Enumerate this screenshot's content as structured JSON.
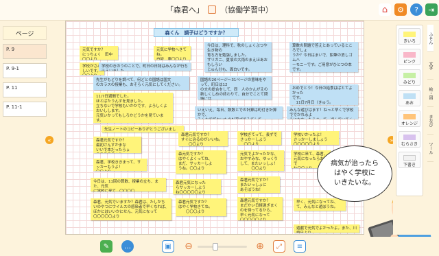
{
  "header": {
    "title": "「森君へ」",
    "mode": "（協働学習中）"
  },
  "left": {
    "label": "ページ",
    "pages": [
      "P. 9",
      "P. 9-1",
      "P. 11",
      "P. 11-1"
    ]
  },
  "board": {
    "heading": "森くん　調子はどうですか？",
    "notes": [
      {
        "t": "元気ですか？\nにっちょく　田中〇〇より",
        "c": "yellow"
      },
      {
        "t": "元気に学校へきてね。\n白坂　東〇〇より",
        "c": "yellow"
      },
      {
        "t": "学校がさみしいです。\n〇〇より",
        "c": "yellow"
      },
      {
        "t": "今日は、理科で、秋のしょくぶつや生き物の\n育ち方を勉強しました。\nザリガニ、夏頃の大雨のまえほあおもしろい\nじゅん分も、面白いです。\n　　　　　　　　　　日氏より",
        "c": "blue"
      },
      {
        "t": "算数の問題で答えとあっているところでしょ\nうか？今日はまいで、鉛筆の消しゴムハ\nーモニーです。ご用意がひとつの本です。\n　　　いそご案をかいてください。",
        "c": "blue"
      },
      {
        "t": "学校のきのうのことで、町日の日誌はみんなが行ち込えいました。",
        "c": "blue"
      },
      {
        "t": "先生がもどりを調べて、何どとの国語は国文\nのカラスの授業も、おそらく元気にしてください。",
        "c": "blue"
      },
      {
        "t": "国語の26ページ～31ページの意味をやって、町日は12\nの文の総合をして、同　人のかんがえの\n新しくしめの終わりて、自分でことて問題に共\n出ます。",
        "c": "blue"
      },
      {
        "t": "おめでとう！今日の給食はぱとてよかった\nです。\n　11日7月日（きゅう。",
        "c": "blue"
      },
      {
        "t": "11/7日週間でした。\nほとばたうんすを見ました。\n立ちないで学校もいかかです、よろしくよおいしします。\n元気いかってもしろかどうかを見ています。\n遊戯たいらいしいよんをまんなが\n　　　　　　　　　　〇〇より",
        "c": "yellow"
      },
      {
        "t": "いえいえ、毎日、数数とでの計算は町付き計算かで、\nみんなで紙ないもの計算ボでみてして。",
        "c": "blue"
      },
      {
        "t": "みんな遊びはます！ねっと早くで学校ででかれるよ\nうになかったらまって、遊んでいてください。",
        "c": "blue"
      },
      {
        "t": "先生ノートのコピーありがとうございました。",
        "c": "yellow"
      },
      {
        "t": "森君元気ですか？\nすぐに治るのがいいね。\n　　〇〇より",
        "c": "yellow"
      },
      {
        "t": "学校ぎてって、長ずで\nさっかーしよう\n　〇〇より",
        "c": "yellow"
      },
      {
        "t": "学校いかったよ！\nさっかーしましょう\n〇〇〇〇〇より",
        "c": "yellow"
      },
      {
        "t": "森君元気ですか？\n最初けんすかまな\nいいで本だったらょ\n〇〇〇〇〇より",
        "c": "yellow"
      },
      {
        "t": "森君、学校ききまって、サッカーもうよ！\n〇〇より",
        "c": "yellow"
      },
      {
        "t": "森元気ですか？\nはやくよくってね、\nまだ、サッカーしよ\nうね。〇〇より",
        "c": "yellow"
      },
      {
        "t": "元気でよかったかな、\nおやすみな、ゆっくり\nして、またいっしょ！\n　　　〇〇より",
        "c": "yellow"
      },
      {
        "t": "学校に来て、森君、\n元気になったらおいで\nね〇〇より",
        "c": "yellow"
      },
      {
        "t": "今日は、11回の算数、授業の立ち、また、元気\nに学校に来て、〇〇〇〇",
        "c": "yellow"
      },
      {
        "t": "森君元気になった\nらサッカーしよう\nね〇〇〇〇〇より",
        "c": "yellow"
      },
      {
        "t": "森君元気ですか？\nまたいっしょに\nあそぼうね！",
        "c": "yellow"
      },
      {
        "t": "森君、元気でいますか？森君は、たしかち\nいのやつにウイルスの感染者で早くなれば、\nほかにはいいかにせん、元気になって\n〇〇〇〇〇より",
        "c": "yellow"
      },
      {
        "t": "森君元気ですか？\nはやく学校きてね。\n　　〇〇〇より",
        "c": "yellow"
      },
      {
        "t": "早く、元気になってね、\nて、みんなと遊ぼうね。",
        "c": "yellow"
      },
      {
        "t": "森君元気ですか？\nまだかい日経過ぎまく\nのを待ってるから、\n早く元気になって\n〇〇〇〇〇より",
        "c": "yellow"
      },
      {
        "t": "遊戯で元気でよかったよ。また、川崎日より",
        "c": "yellow"
      }
    ]
  },
  "tools": [
    "きいろ",
    "ピンク",
    "みどり",
    "あお",
    "オレンジ",
    "むらさき",
    "下書き"
  ],
  "tool_colors": [
    "#fff47a",
    "#f9b7c9",
    "#c6f0a5",
    "#bfe0f5",
    "#ffc47a",
    "#d8c2ee",
    "#f2f2f2"
  ],
  "tabs": [
    "ふせん",
    "文字",
    "絵・図",
    "まなび",
    "ツール"
  ],
  "speech": "病気が治ったら\nはやく学校に\nいきたいな。",
  "colors": {
    "accent": "#f5a623",
    "canvas_grid": "#f3d8d8",
    "sticky_yellow": "#fff47a",
    "sticky_blue": "#bfe0f5"
  },
  "icons": [
    "home-icon",
    "settings-icon",
    "help-icon",
    "exit-icon",
    "notebook-icon",
    "chat-icon",
    "photo-icon",
    "zoom-out-icon",
    "zoom-in-icon",
    "fit-icon",
    "layers-icon",
    "close-icon"
  ]
}
